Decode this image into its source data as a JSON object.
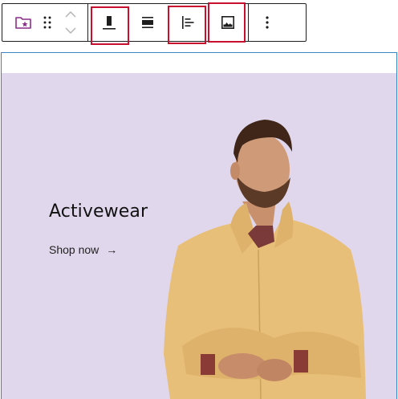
{
  "toolbar": {
    "items": [
      {
        "name": "block-type-icon",
        "tooltip": "Cover"
      },
      {
        "name": "drag-handle-icon",
        "tooltip": "Drag"
      },
      {
        "name": "move-up-icon",
        "tooltip": "Move up"
      },
      {
        "name": "move-down-icon",
        "tooltip": "Move down"
      },
      {
        "name": "align-bottom-icon",
        "tooltip": "Change content position"
      },
      {
        "name": "full-width-icon",
        "tooltip": "Align"
      },
      {
        "name": "justify-left-icon",
        "tooltip": "Justify"
      },
      {
        "name": "replace-image-icon",
        "tooltip": "Replace"
      },
      {
        "name": "more-options-icon",
        "tooltip": "Options"
      }
    ],
    "highlighted": [
      "align-bottom-icon",
      "justify-left-icon",
      "replace-image-icon"
    ]
  },
  "cover": {
    "heading": "Activewear",
    "link_label": "Shop now",
    "link_arrow": "→",
    "background_color": "#e0d7ec"
  },
  "colors": {
    "accent": "#8a2f8a",
    "highlight": "#c8102e",
    "block_border": "#3a86c5"
  }
}
